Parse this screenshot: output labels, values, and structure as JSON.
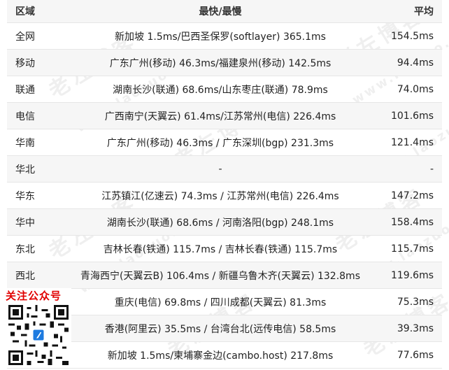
{
  "table": {
    "headers": {
      "region": "区域",
      "fastest_slowest": "最快/最慢",
      "average": "平均"
    },
    "rows": [
      {
        "region": "全网",
        "fastest_slowest": "新加坡 1.5ms/巴西圣保罗(softlayer) 365.1ms",
        "average": "154.5ms"
      },
      {
        "region": "移动",
        "fastest_slowest": "广东广州(移动) 46.3ms/福建泉州(移动) 142.5ms",
        "average": "94.4ms"
      },
      {
        "region": "联通",
        "fastest_slowest": "湖南长沙(联通) 68.6ms/山东枣庄(联通) 78.9ms",
        "average": "74.0ms"
      },
      {
        "region": "电信",
        "fastest_slowest": "广西南宁(天翼云) 61.4ms/江苏常州(电信) 226.4ms",
        "average": "101.6ms"
      },
      {
        "region": "华南",
        "fastest_slowest": "广东广州(移动) 46.3ms / 广东深圳(bgp) 231.3ms",
        "average": "121.4ms"
      },
      {
        "region": "华北",
        "fastest_slowest": "-",
        "average": "-"
      },
      {
        "region": "华东",
        "fastest_slowest": "江苏镇江(亿速云) 74.3ms / 江苏常州(电信) 226.4ms",
        "average": "147.2ms"
      },
      {
        "region": "华中",
        "fastest_slowest": "湖南长沙(联通) 68.6ms / 河南洛阳(bgp) 248.1ms",
        "average": "158.4ms"
      },
      {
        "region": "东北",
        "fastest_slowest": "吉林长春(铁通) 115.7ms / 吉林长春(铁通) 115.7ms",
        "average": "115.7ms"
      },
      {
        "region": "西北",
        "fastest_slowest": "青海西宁(天翼云B) 106.4ms / 新疆乌鲁木齐(天翼云) 132.8ms",
        "average": "119.6ms"
      },
      {
        "region": "",
        "fastest_slowest": "重庆(电信) 69.8ms / 四川成都(天翼云) 81.3ms",
        "average": "75.3ms"
      },
      {
        "region": "",
        "fastest_slowest": "香港(阿里云) 35.5ms / 台湾台北(远传电信) 58.5ms",
        "average": "39.3ms"
      },
      {
        "region": "",
        "fastest_slowest": "新加坡 1.5ms/柬埔寨金边(cambo.host) 217.8ms",
        "average": "77.6ms"
      }
    ]
  },
  "watermark": {
    "cn": "老左博客",
    "url": "www.laozuo.org"
  },
  "promo": {
    "title": "关注公众号",
    "qr_icon": "qr-code-icon"
  }
}
